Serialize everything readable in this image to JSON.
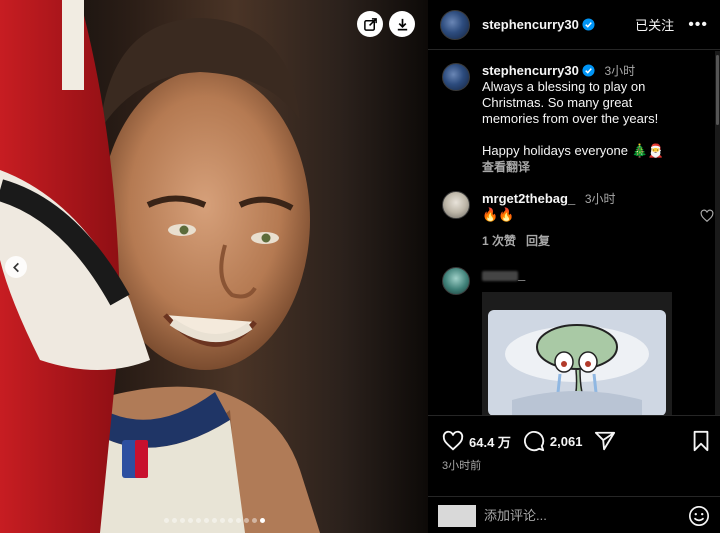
{
  "media": {
    "dots_total": 13,
    "active_dot": 12,
    "share_icon": "share-icon",
    "download_icon": "download-icon",
    "prev_icon": "chevron-left-icon"
  },
  "header": {
    "username": "stephencurry30",
    "follow_status": "已关注",
    "more_icon": "more-icon"
  },
  "caption": {
    "username": "stephencurry30",
    "time": "3小时",
    "text_line1": "Always a blessing to play on",
    "text_line2": "Christmas. So many great",
    "text_line3": "memories from over the years!",
    "text_line4": "Happy holidays everyone 🎄🎅",
    "translate": "查看翻译"
  },
  "comments": [
    {
      "username": "mrget2thebag_",
      "time": "3小时",
      "text": "🔥🔥",
      "likes": "1 次赞",
      "reply": "回复"
    },
    {
      "username_tail": "_",
      "attachment": "squidward-meme"
    }
  ],
  "actions": {
    "like_count": "64.4 万",
    "comment_count": "2,061",
    "post_time": "3小时前",
    "icons": [
      "heart-icon",
      "comment-icon",
      "send-icon",
      "bookmark-icon"
    ]
  },
  "comment_box": {
    "placeholder": "添加评论..."
  },
  "colors": {
    "background": "#000000",
    "verified": "#0095f6",
    "muted_text": "#a8a8a8",
    "divider": "#262626"
  }
}
